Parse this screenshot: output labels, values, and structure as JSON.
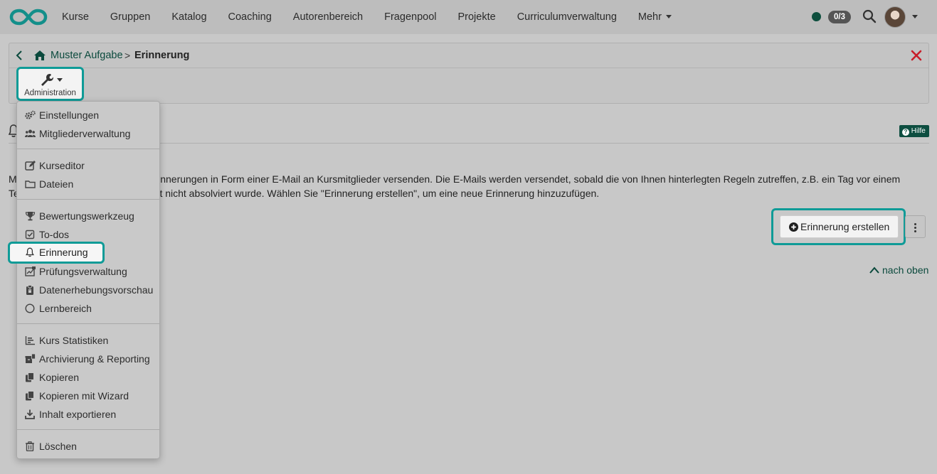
{
  "navbar": {
    "items": [
      "Kurse",
      "Gruppen",
      "Katalog",
      "Coaching",
      "Autorenbereich",
      "Fragenpool",
      "Projekte",
      "Curriculumverwaltung",
      "Mehr"
    ],
    "status_count": "0/3"
  },
  "breadcrumb": {
    "course": "Muster Aufgabe",
    "separator": ">",
    "current": "Erinnerung"
  },
  "toolbar": {
    "admin_label": "Administration"
  },
  "menu": {
    "group1": [
      "Einstellungen",
      "Mitgliederverwaltung"
    ],
    "group2": [
      "Kurseditor",
      "Dateien"
    ],
    "group3": [
      "Bewertungswerkzeug",
      "To-dos",
      "Erinnerung",
      "Prüfungsverwaltung",
      "Datenerhebungsvorschau",
      "Lernbereich"
    ],
    "group4": [
      "Kurs Statistiken",
      "Archivierung & Reporting",
      "Kopieren",
      "Kopieren mit Wizard",
      "Inhalt exportieren"
    ],
    "group5": [
      "Löschen"
    ]
  },
  "page": {
    "help_label": "Hilfe",
    "intro_line1": "Mit dieser Funktion können Sie Erinnerungen in Form einer E-Mail an Kursmitglieder versenden. Die E-Mails werden versendet, sobald die von Ihnen hinterlegten Regeln zutreffen, z.B. ein Tag vor einem",
    "intro_line2": "Termin oder wenn ein Kurselement nicht absolviert wurde. Wählen Sie \"Erinnerung erstellen\", um eine neue Erinnerung hinzuzufügen.",
    "create_button": "Erinnerung erstellen",
    "back_to_top": "nach oben"
  },
  "colors": {
    "highlight": "#0f9b97",
    "brand": "#0b4a3d",
    "close": "#c81e2a"
  }
}
